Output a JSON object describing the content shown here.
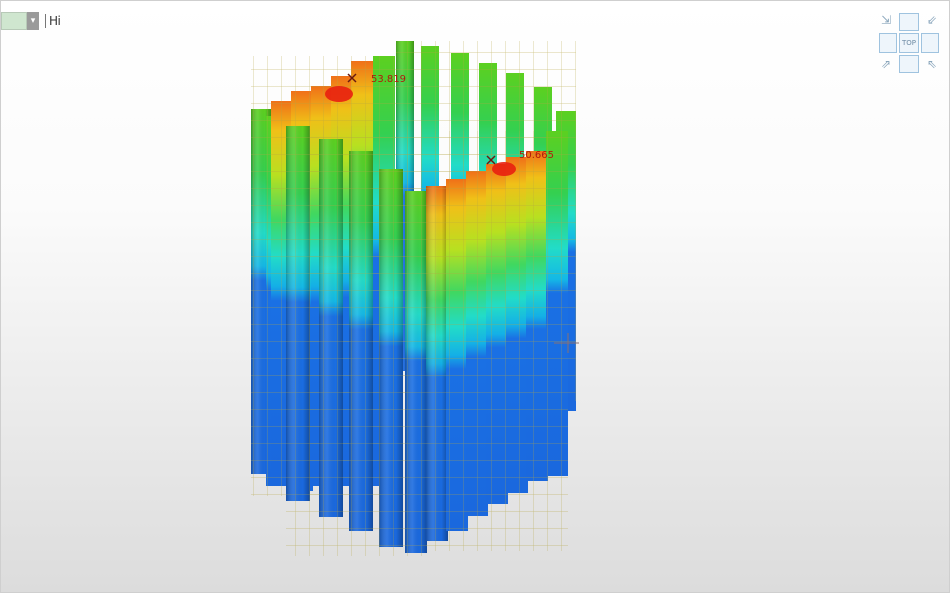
{
  "toolbar": {
    "dropdown_arrow": "▾",
    "label": "Hi"
  },
  "viewcube": {
    "top_label": "TOP",
    "icons": [
      "arrow-nw-icon",
      "arrow-ne-icon",
      "arrow-sw-icon",
      "arrow-se-icon"
    ]
  },
  "probes": [
    {
      "label": "53.819"
    },
    {
      "label": "50.665"
    }
  ],
  "colors": {
    "background_top": "#ffffff",
    "background_bottom": "#dcdcdc",
    "contour_scale": [
      "#1a6ee6",
      "#14b4e6",
      "#20e0cc",
      "#40e060",
      "#a8e020",
      "#f0d818",
      "#f08a18",
      "#e82010"
    ],
    "mesh_line": "#b5a642"
  }
}
